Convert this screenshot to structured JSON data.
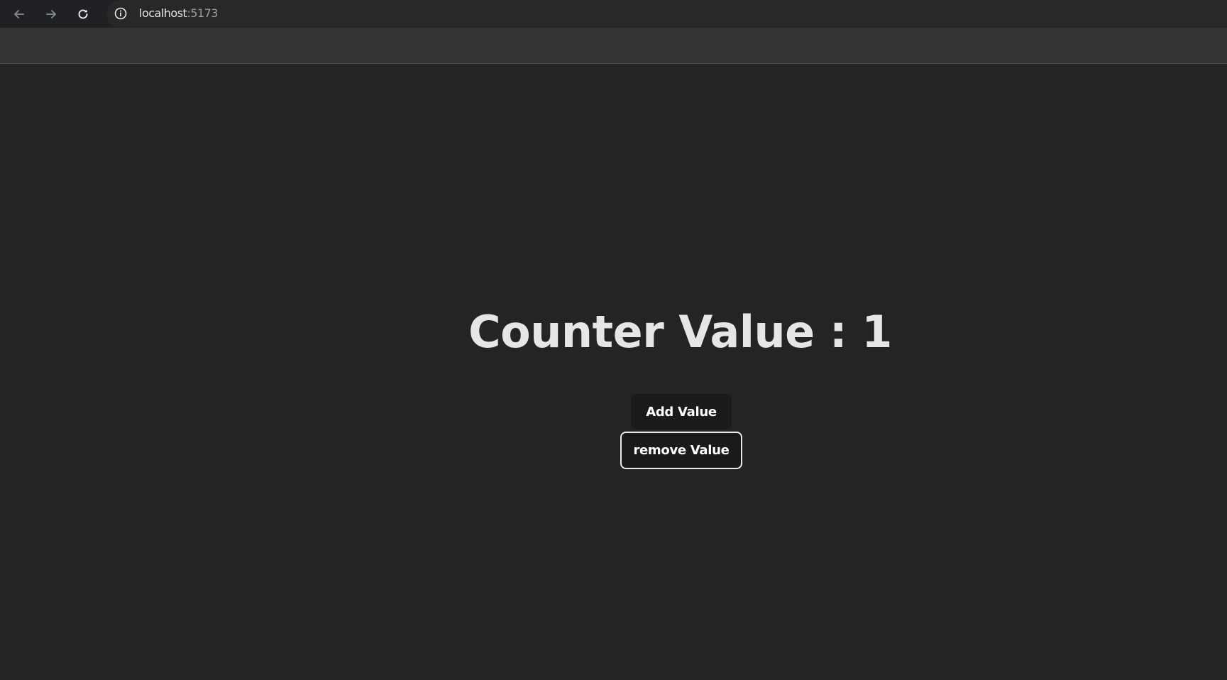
{
  "browser": {
    "url_host": "localhost",
    "url_port": ":5173",
    "back_icon": "arrow-left-icon",
    "forward_icon": "arrow-right-icon",
    "reload_icon": "reload-icon",
    "site_info_icon": "info-icon"
  },
  "app": {
    "counter_label": "Counter Value : 1",
    "add_button_label": "Add Value",
    "remove_button_label": "remove Value"
  },
  "colors": {
    "page_background": "#242424",
    "button_background": "#1a1a1a",
    "text": "#e6e6e6"
  }
}
